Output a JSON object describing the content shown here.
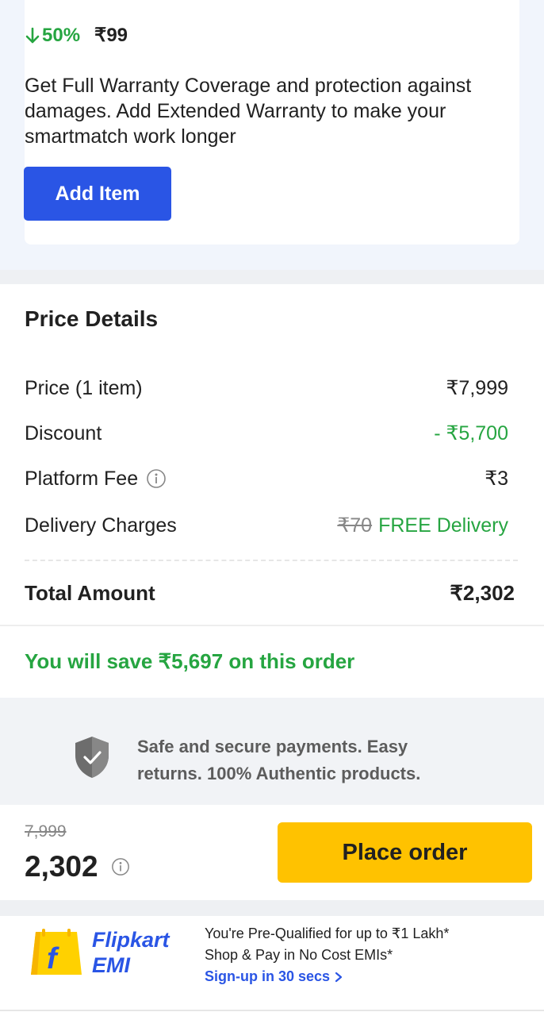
{
  "warranty": {
    "discount": "50%",
    "price": "₹99",
    "description": "Get Full Warranty Coverage and protection against damages. Add Extended Warranty to make your smartmatch work longer",
    "add_button": "Add Item"
  },
  "price_details": {
    "title": "Price Details",
    "rows": [
      {
        "label": "Price (1 item)",
        "value": "₹7,999"
      },
      {
        "label": "Discount",
        "value": "- ₹5,700"
      },
      {
        "label": "Platform Fee",
        "value": "₹3"
      },
      {
        "label": "Delivery Charges",
        "original": "₹70",
        "value": "FREE Delivery"
      }
    ],
    "total_label": "Total Amount",
    "total_value": "₹2,302",
    "savings": "You will save ₹5,697 on this order"
  },
  "secure": {
    "text": "Safe and secure payments. Easy returns. 100% Authentic products."
  },
  "bottom_bar": {
    "old_price": "7,999",
    "new_price": "2,302",
    "place_order": "Place order"
  },
  "emi": {
    "brand_line1": "Flipkart",
    "brand_line2": "EMI",
    "line1": "You're Pre-Qualified for up to ₹1 Lakh*",
    "line2": "Shop & Pay in No Cost EMIs*",
    "link": "Sign-up in 30 secs"
  },
  "colors": {
    "green": "#26a541",
    "blue": "#2a55e5",
    "yellow": "#ffc200"
  }
}
